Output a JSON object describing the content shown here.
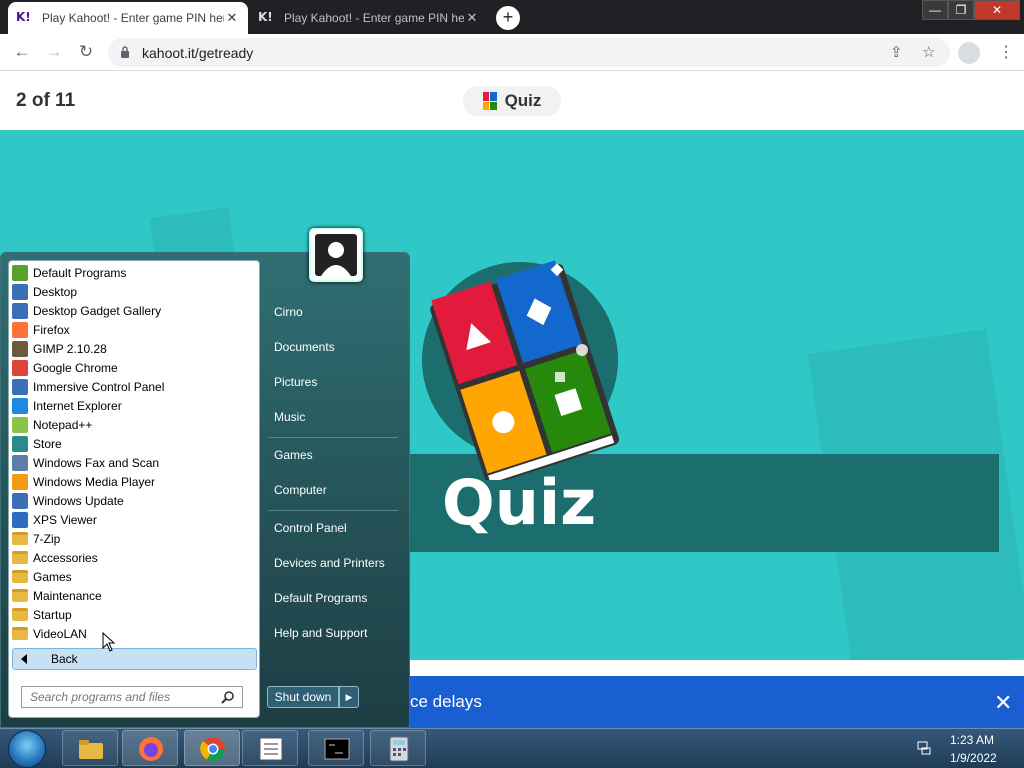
{
  "browser": {
    "tabs": [
      {
        "favicon": "K!",
        "title": "Play Kahoot! - Enter game PIN here!",
        "close": "✕"
      },
      {
        "favicon": "K!",
        "title": "Play Kahoot! - Enter game PIN here!",
        "close": "✕"
      }
    ],
    "new_tab": "+",
    "url": "kahoot.it/getready",
    "window_controls": {
      "minimize": "—",
      "restore": "❐",
      "close": "✕"
    }
  },
  "page": {
    "progress": "2 of 11",
    "question_type_pill": "Quiz",
    "stage_title": "Quiz",
    "notice_text": "ce delays",
    "notice_close": "✕"
  },
  "start_menu": {
    "programs": [
      "Default Programs",
      "Desktop",
      "Desktop Gadget Gallery",
      "Firefox",
      "GIMP 2.10.28",
      "Google Chrome",
      "Immersive Control Panel",
      "Internet Explorer",
      "Notepad++",
      "Store",
      "Windows Fax and Scan",
      "Windows Media Player",
      "Windows Update",
      "XPS Viewer",
      "7-Zip",
      "Accessories",
      "Games",
      "Maintenance",
      "Startup",
      "VideoLAN"
    ],
    "back": "Back",
    "search_placeholder": "Search programs and files",
    "right_items": [
      "Cirno",
      "Documents",
      "Pictures",
      "Music",
      "Games",
      "Computer",
      "Control Panel",
      "Devices and Printers",
      "Default Programs",
      "Help and Support"
    ],
    "shutdown": "Shut down",
    "shutdown_arrow": "▶"
  },
  "taskbar": {
    "time": "1:23 AM",
    "date": "1/9/2022"
  },
  "colors": {
    "stage": "#2fc8c7",
    "banner": "#1c6e6e",
    "notice_bar": "#1a5fd1",
    "red": "#e21b3c",
    "blue": "#1368ce",
    "yellow": "#ffa602",
    "green": "#26890c"
  }
}
